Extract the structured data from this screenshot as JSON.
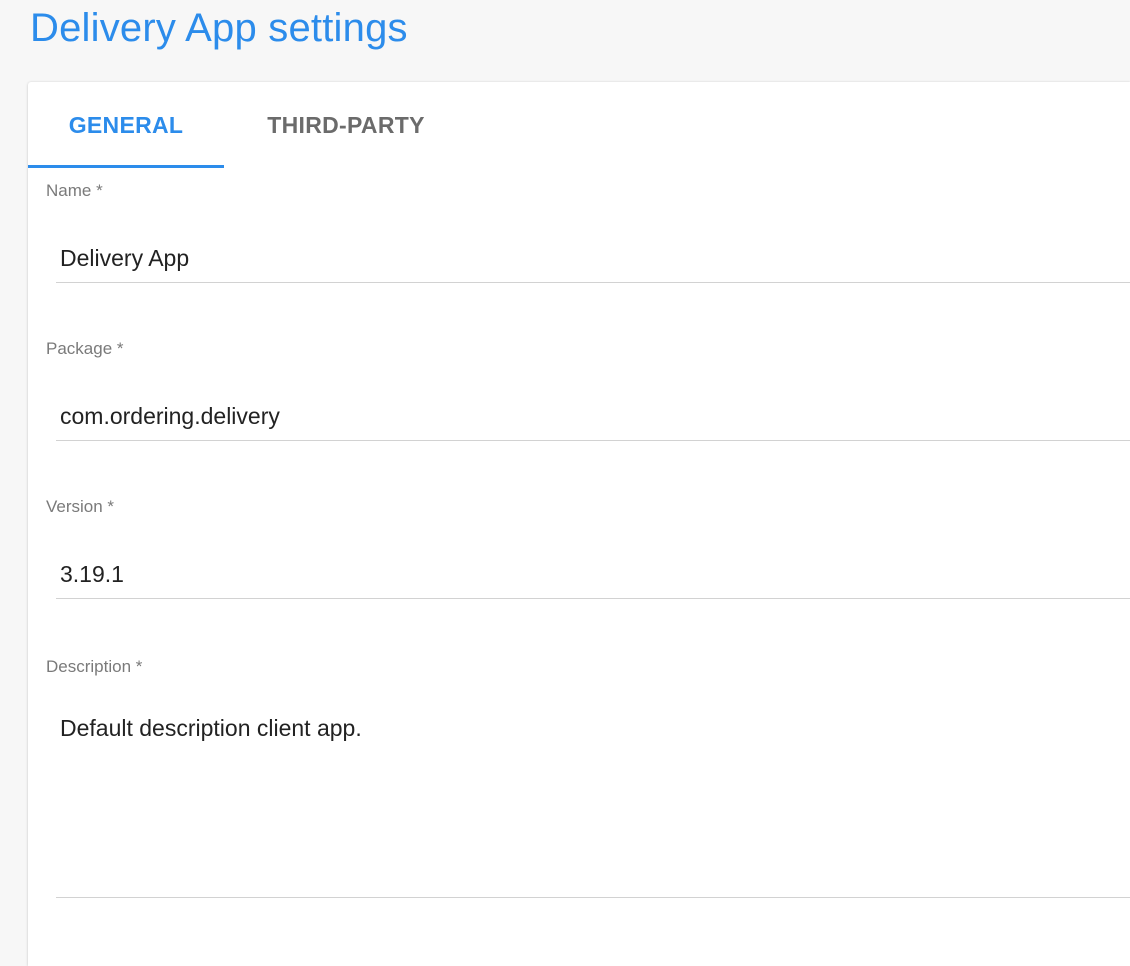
{
  "header": {
    "title": "Delivery App settings"
  },
  "tabs": [
    {
      "label": "GENERAL",
      "active": true
    },
    {
      "label": "THIRD-PARTY",
      "active": false
    }
  ],
  "form": {
    "name": {
      "label": "Name *",
      "value": "Delivery App"
    },
    "package": {
      "label": "Package *",
      "value": "com.ordering.delivery"
    },
    "version": {
      "label": "Version *",
      "value": "3.19.1"
    },
    "description": {
      "label": "Description *",
      "value": "Default description client app."
    }
  },
  "colors": {
    "accent": "#2c8ceb",
    "tab_inactive": "#6b6b6b",
    "label": "#7a7a7a",
    "input_text": "#222222",
    "underline": "#d2d2d2"
  }
}
